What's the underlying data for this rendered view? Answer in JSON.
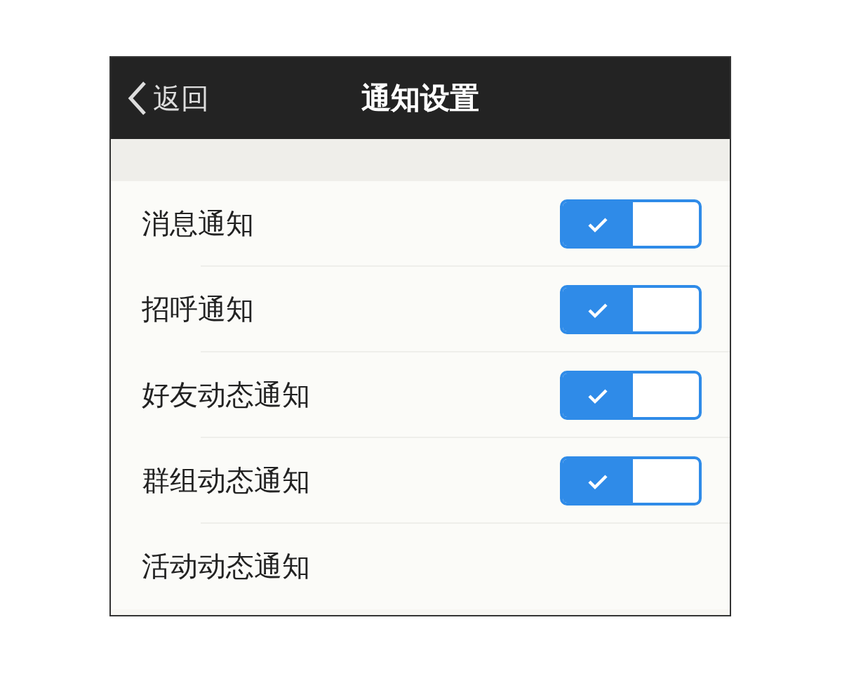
{
  "header": {
    "back": "返回",
    "title": "通知设置"
  },
  "settings": [
    {
      "label": "消息通知",
      "on": true
    },
    {
      "label": "招呼通知",
      "on": true
    },
    {
      "label": "好友动态通知",
      "on": true
    },
    {
      "label": "群组动态通知",
      "on": true
    },
    {
      "label": "活动动态通知"
    }
  ]
}
